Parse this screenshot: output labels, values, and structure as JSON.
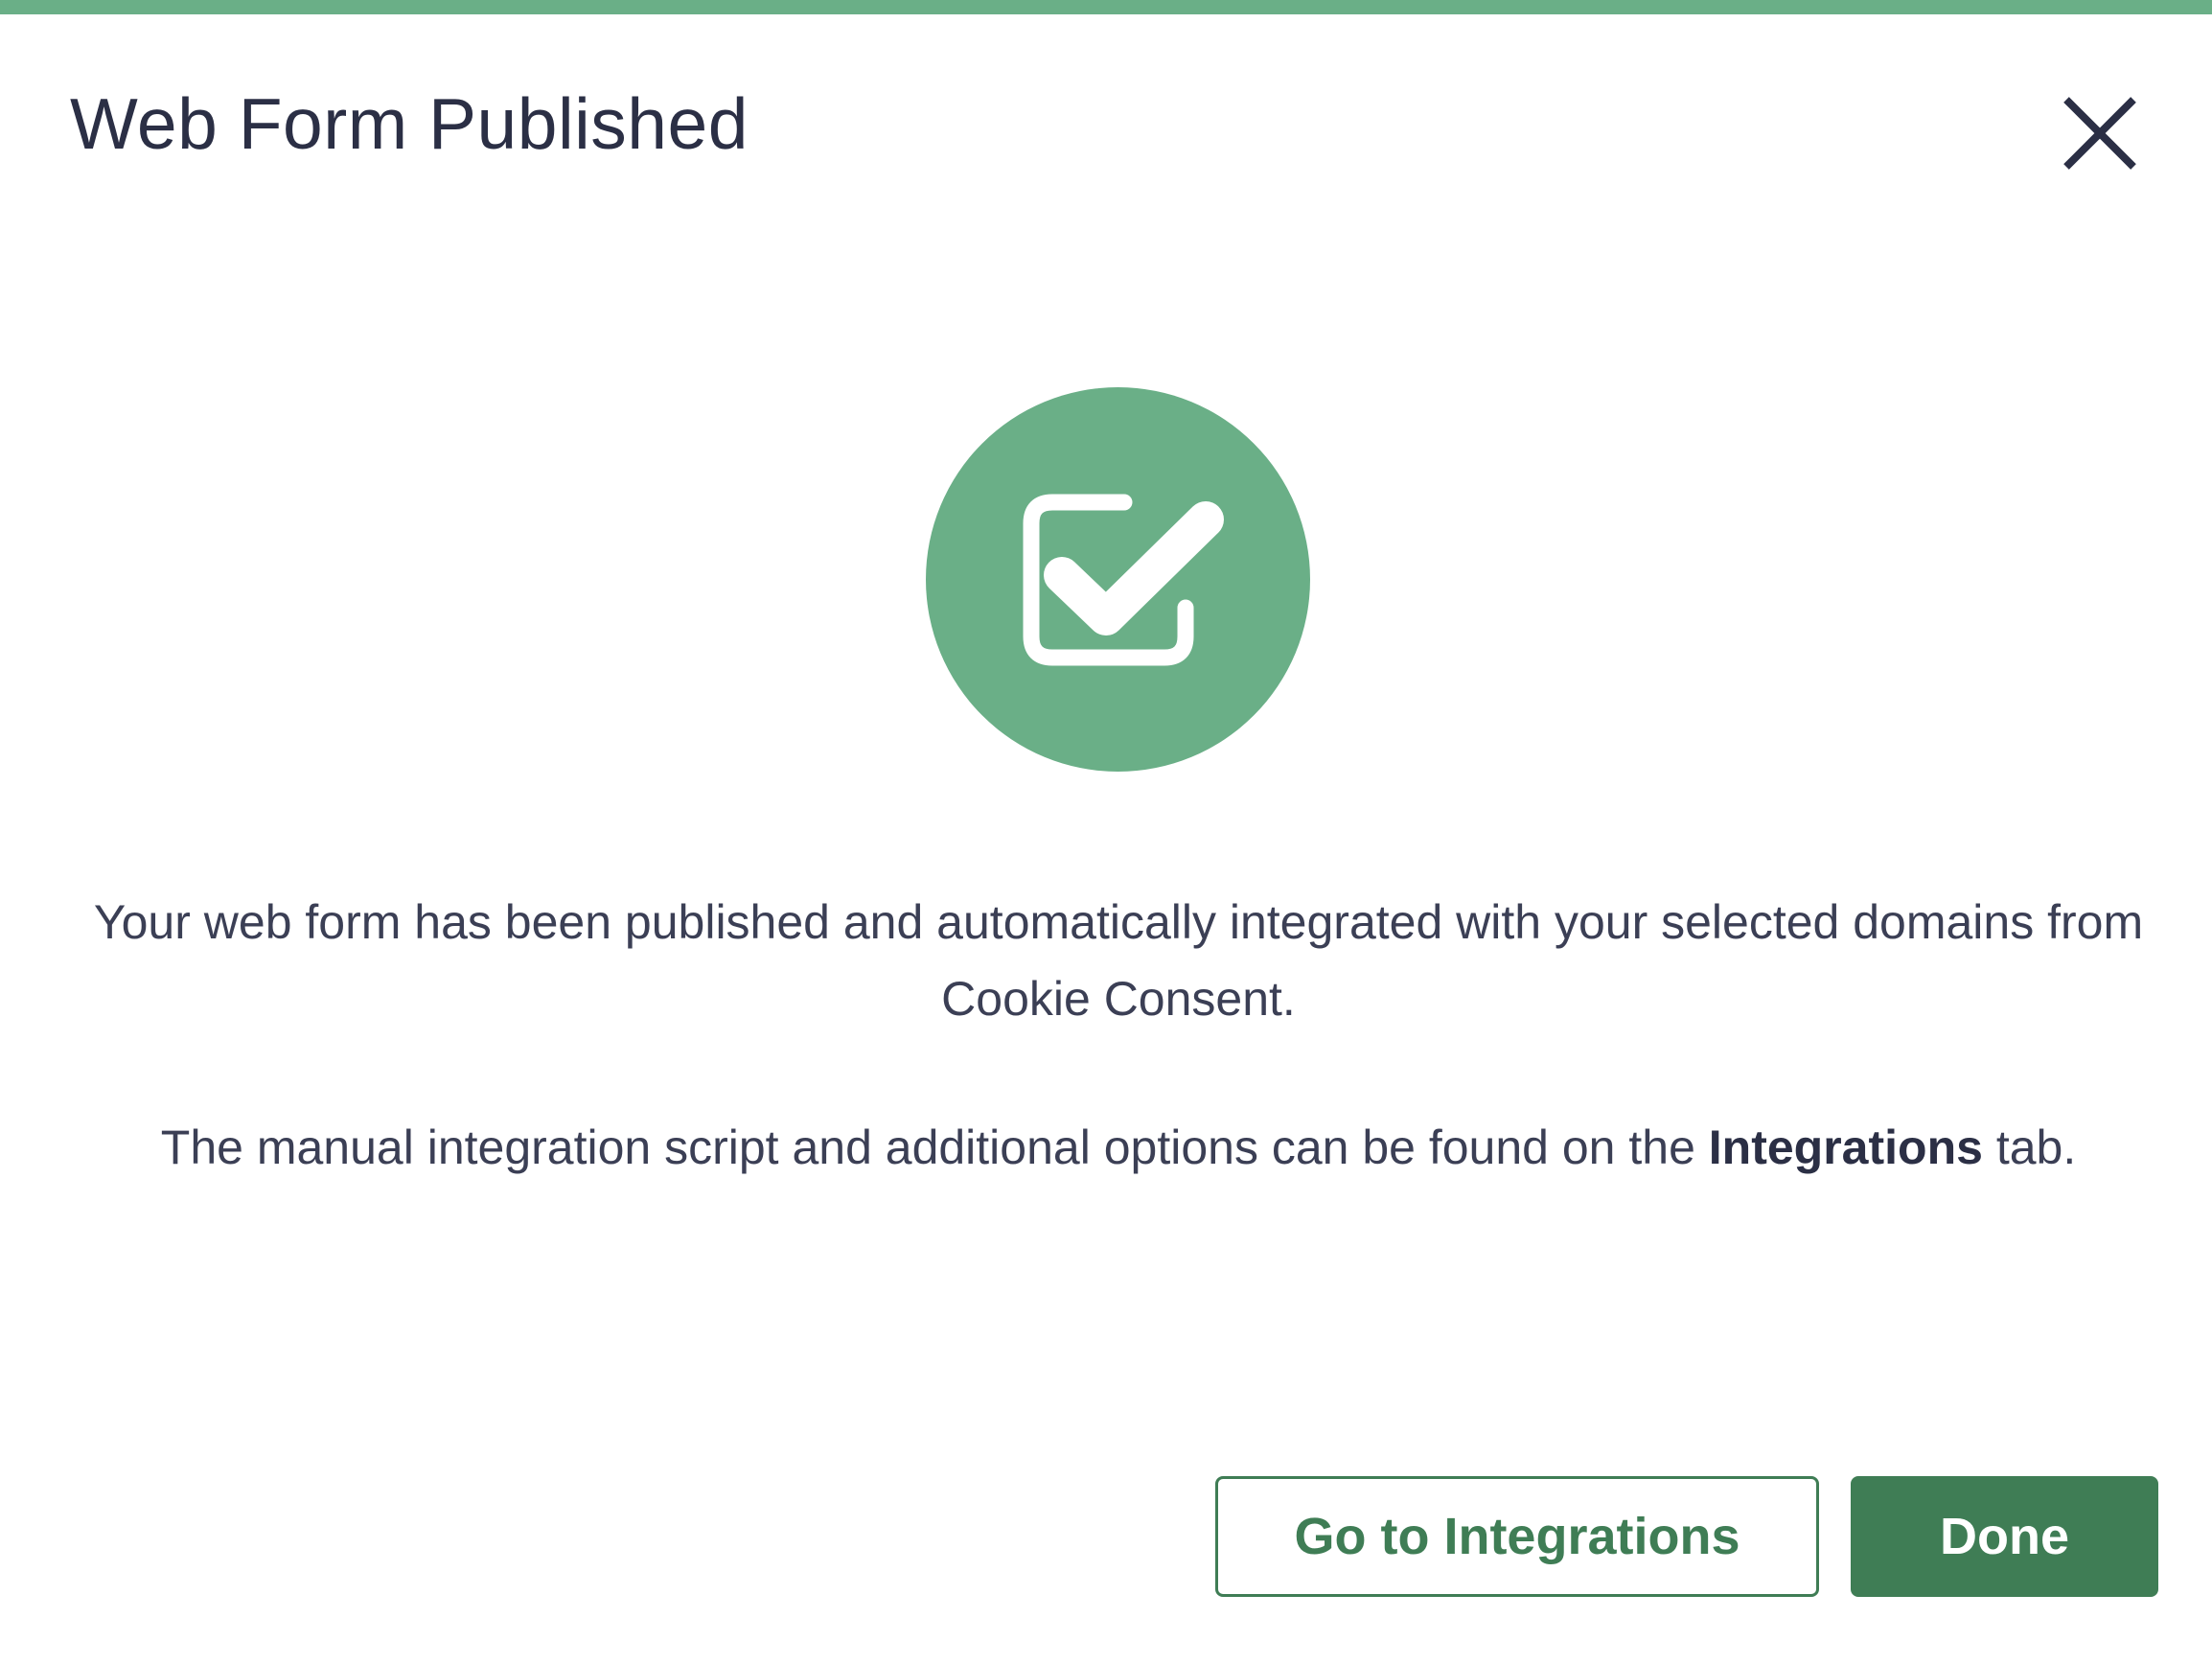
{
  "dialog": {
    "title": "Web Form Published",
    "close_label": "Close",
    "accent_color": "#6aaf87",
    "primary_color": "#3f7d55",
    "icon": "checkbox-checked-icon",
    "message_1": "Your web form has been published and automatically integrated with your selected domains from Cookie Consent.",
    "message_2_prefix": "The manual integration script and additional options can be found on the ",
    "message_2_bold": "Integrations",
    "message_2_suffix": " tab.",
    "secondary_button_label": "Go to Integrations",
    "primary_button_label": "Done"
  }
}
